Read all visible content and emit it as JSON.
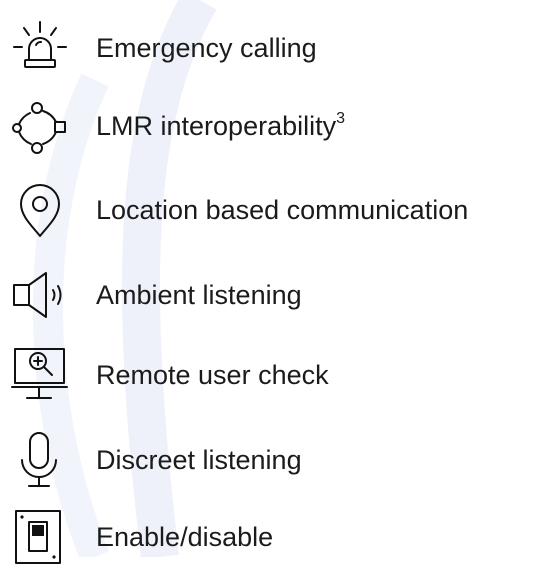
{
  "theme": {
    "text_color": "#1b1b1b",
    "icon_color": "#111111",
    "decoration_color": "#eef1fa"
  },
  "features": [
    {
      "icon": "siren-icon",
      "label": "Emergency calling"
    },
    {
      "icon": "network-nodes-icon",
      "label": "LMR interoperability",
      "footnote": "3"
    },
    {
      "icon": "location-pin-icon",
      "label": "Location based communication"
    },
    {
      "icon": "speaker-icon",
      "label": "Ambient listening"
    },
    {
      "icon": "monitor-zoom-icon",
      "label": "Remote user check"
    },
    {
      "icon": "microphone-icon",
      "label": "Discreet listening"
    },
    {
      "icon": "switch-icon",
      "label": "Enable/disable"
    }
  ]
}
